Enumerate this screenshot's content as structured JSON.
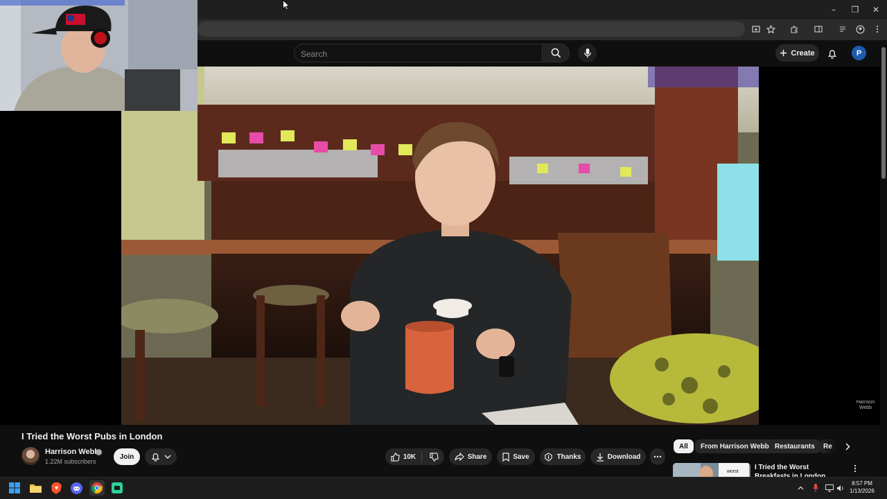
{
  "search": {
    "placeholder": "Search"
  },
  "masthead": {
    "create_label": "Create",
    "avatar_letter": "P"
  },
  "video": {
    "title": "I Tried the Worst Pubs in London",
    "watermark_line1": "Harrison",
    "watermark_line2": "Webb"
  },
  "channel": {
    "name": "Harrison Webb",
    "subscribers": "1.22M subscribers",
    "join_label": "Join"
  },
  "actions": {
    "like_count": "10K",
    "share_label": "Share",
    "save_label": "Save",
    "thanks_label": "Thanks",
    "download_label": "Download"
  },
  "chips": [
    "All",
    "From Harrison Webb",
    "Restaurants",
    "Re"
  ],
  "recommendation": {
    "title": "I Tried the Worst Breakfasts in London",
    "thumb_text": "worst"
  },
  "taskbar": {
    "time": "8:57 PM",
    "date": "1/13/2026"
  },
  "colors": {
    "youtube_accent": "#ff0000",
    "avatar_bg": "#1e5bb0",
    "taskbar_bg": "#1c1c1c"
  }
}
